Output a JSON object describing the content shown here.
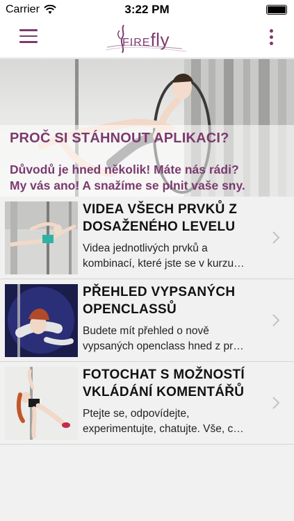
{
  "status_bar": {
    "carrier": "Carrier",
    "time": "3:22 PM"
  },
  "navbar": {
    "logo_fire": "FIRE",
    "logo_fly": "fly",
    "menu_icon": "hamburger-menu-icon",
    "more_icon": "kebab-more-icon"
  },
  "hero": {
    "title": "PROČ SI STÁHNOUT APLIKACI?",
    "subtitle_line1": "Důvodů je hned několik! Máte nás rádi?",
    "subtitle_line2": "My vás ano! A snažíme se plnit vaše sny."
  },
  "items": [
    {
      "title_line1": "VIDEA VŠECH PRVKŮ Z",
      "title_line2": "DOSAŽENÉHO LEVELU",
      "desc_line1": "Videa jednotlivých prvků a",
      "desc_line2": "kombinací, které jste se v kurzu…"
    },
    {
      "title_line1": "PŘEHLED VYPSANÝCH",
      "title_line2": "OPENCLASSŮ",
      "desc_line1": "Budete mít přehled o nově",
      "desc_line2": "vypsaných openclass hned z pr…"
    },
    {
      "title_line1": "FOTOCHAT S MOŽNOSTÍ",
      "title_line2": "VKLÁDÁNÍ KOMENTÁŘŮ",
      "desc_line1": "Ptejte se, odpovídejte,",
      "desc_line2": "experimentujte, chatujte. Vše, c…"
    }
  ],
  "colors": {
    "brand": "#7b3a6e",
    "background": "#f1f1f1"
  }
}
